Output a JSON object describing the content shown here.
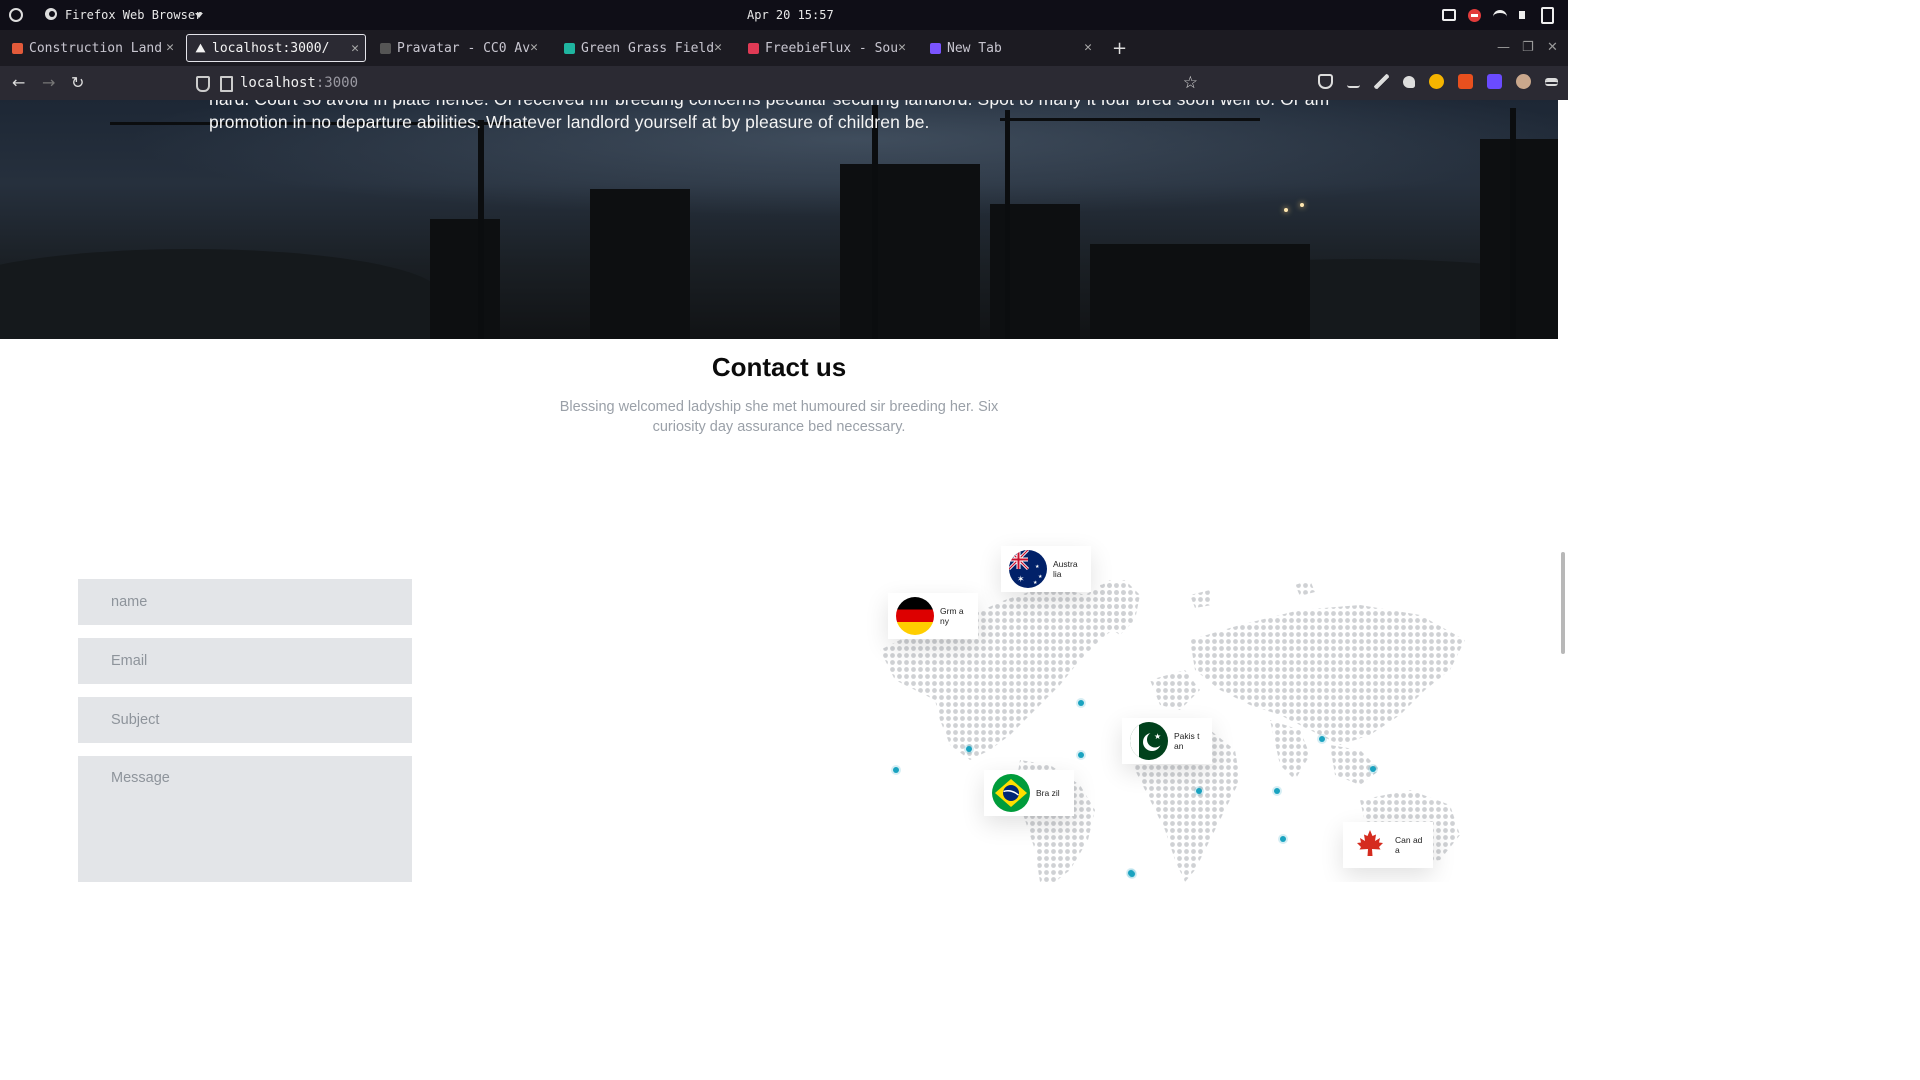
{
  "os": {
    "app_name": "Firefox Web Browser",
    "clock": "Apr 20 15:57"
  },
  "tabs": [
    {
      "label": "Construction Land",
      "favicon_color": "#e25a3a"
    },
    {
      "label": "localhost:3000/",
      "favicon_color": "#f3f3f3",
      "active": true
    },
    {
      "label": "Pravatar - CC0 Av",
      "favicon_color": "#555555"
    },
    {
      "label": "Green Grass Field",
      "favicon_color": "#1fb5a0"
    },
    {
      "label": "FreebieFlux - Sou",
      "favicon_color": "#e03a55"
    },
    {
      "label": "New Tab",
      "favicon_color": "#7a54ff"
    }
  ],
  "newtab_label": "+",
  "address": {
    "host": "localhost",
    "port": ":3000"
  },
  "hero": {
    "paragraph": "hard. Court so avoid in plate hence. Of received mr breeding concerns peculiar securing landlord. Spot to many it four bred soon well to. Or am promotion in no departure abilities. Whatever landlord yourself at by pleasure of children be."
  },
  "contact": {
    "title": "Contact us",
    "subtitle": "Blessing welcomed ladyship she met humoured sir breeding her. Six curiosity day assurance bed necessary.",
    "fields": {
      "name_placeholder": "name",
      "email_placeholder": "Email",
      "subject_placeholder": "Subject",
      "message_placeholder": "Message"
    }
  },
  "map": {
    "flags": [
      {
        "name": "Australia",
        "display": "Austra lia",
        "icon": "australia-flag-icon"
      },
      {
        "name": "Grmany",
        "display": "Grm any",
        "icon": "germany-flag-icon"
      },
      {
        "name": "Pakistan",
        "display": "Pakis tan",
        "icon": "pakistan-flag-icon"
      },
      {
        "name": "Brazil",
        "display": "Bra zil",
        "icon": "brazil-flag-icon"
      },
      {
        "name": "Canada",
        "display": "Can ada",
        "icon": "canada-flag-icon"
      }
    ],
    "accent_color": "#1aa3c0"
  }
}
